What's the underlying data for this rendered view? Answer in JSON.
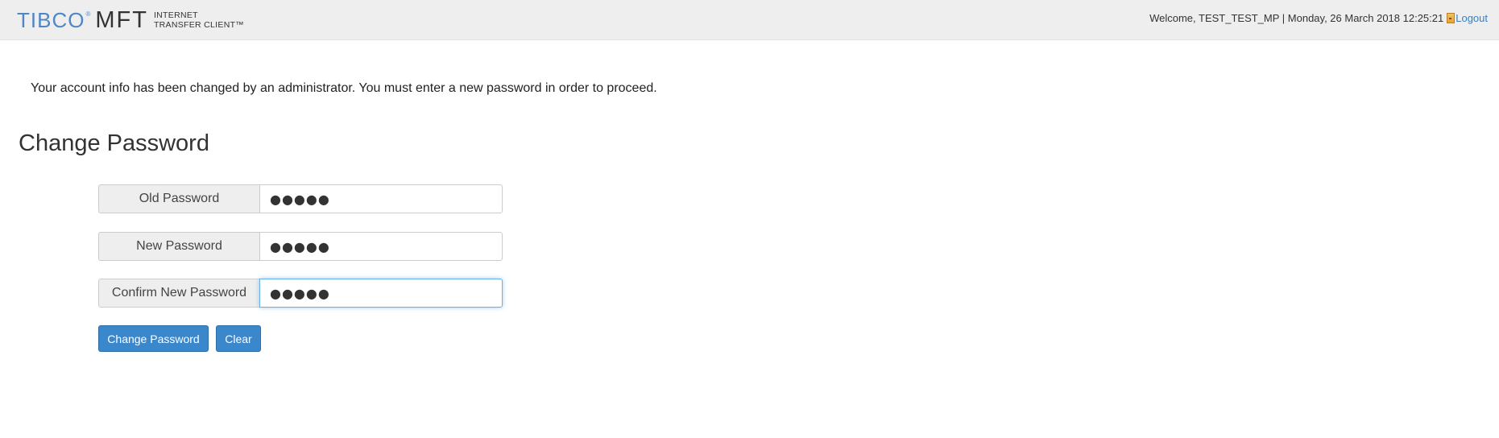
{
  "header": {
    "logo": {
      "brand": "TIBCO",
      "registered": "®",
      "product": "MFT",
      "subtitle_line1": "INTERNET",
      "subtitle_line2": "TRANSFER CLIENT™"
    },
    "welcome_text": "Welcome, TEST_TEST_MP | Monday, 26 March 2018 12:25:21",
    "logout_label": "Logout",
    "logout_icon": "logout-icon"
  },
  "notice": "Your account info has been changed by an administrator. You must enter a new password in order to proceed.",
  "page_title": "Change Password",
  "form": {
    "old_password": {
      "label": "Old Password",
      "value": "●●●●●"
    },
    "new_password": {
      "label": "New Password",
      "value": "●●●●●"
    },
    "confirm_password": {
      "label": "Confirm New Password",
      "value": "●●●●●"
    }
  },
  "buttons": {
    "change_label": "Change Password",
    "clear_label": "Clear"
  },
  "colors": {
    "accent": "#3a87cc",
    "header_bg": "#eeeeee",
    "logo_blue": "#4f86c6"
  }
}
